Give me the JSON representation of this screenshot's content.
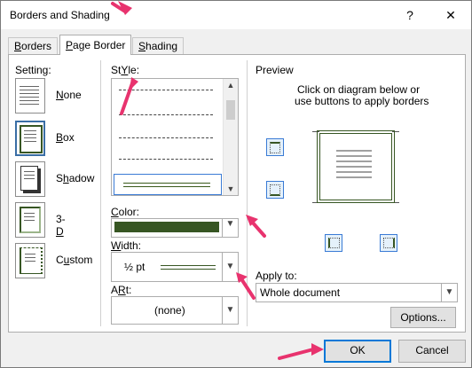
{
  "window": {
    "title": "Borders and Shading",
    "help_glyph": "?",
    "close_glyph": "✕"
  },
  "tabs": [
    {
      "label": "Borders",
      "mnemonic": "B",
      "rest": "orders"
    },
    {
      "label": "Page Border",
      "mnemonic": "P",
      "rest": "age Border"
    },
    {
      "label": "Shading",
      "mnemonic": "S",
      "rest": "hading"
    }
  ],
  "setting": {
    "label": "Setting:",
    "items": [
      {
        "label": "None",
        "mnemonic": "N",
        "rest": "one"
      },
      {
        "label": "Box",
        "mnemonic": "B",
        "rest": "ox"
      },
      {
        "label": "Shadow",
        "mnemonic": "h",
        "prefix": "S",
        "rest": "adow"
      },
      {
        "label": "3-D",
        "mnemonic": "D",
        "prefix": "3-",
        "rest": ""
      },
      {
        "label": "Custom",
        "mnemonic": "u",
        "prefix": "C",
        "rest": "stom"
      }
    ]
  },
  "style": {
    "label": "Style:",
    "mnemonic": "Y",
    "prefix": "St",
    "rest": "le:"
  },
  "color": {
    "label": "Color:",
    "mnemonic": "C",
    "rest": "olor:",
    "value_color": "#375623"
  },
  "width": {
    "label": "Width:",
    "mnemonic": "W",
    "rest": "idth:",
    "value": "½ pt"
  },
  "art": {
    "label": "Art:",
    "mnemonic": "R",
    "prefix": "A",
    "rest": "t:",
    "value": "(none)"
  },
  "preview": {
    "label": "Preview",
    "instruction_line1": "Click on diagram below or",
    "instruction_line2": "use buttons to apply borders"
  },
  "apply_to": {
    "label": "Apply to:",
    "mnemonic": "L",
    "value": "Whole document"
  },
  "buttons": {
    "options": "Options...",
    "ok": "OK",
    "cancel": "Cancel"
  },
  "colors": {
    "accent": "#0078d7",
    "annotation_arrow": "#e8336e",
    "border_green": "#375623"
  }
}
